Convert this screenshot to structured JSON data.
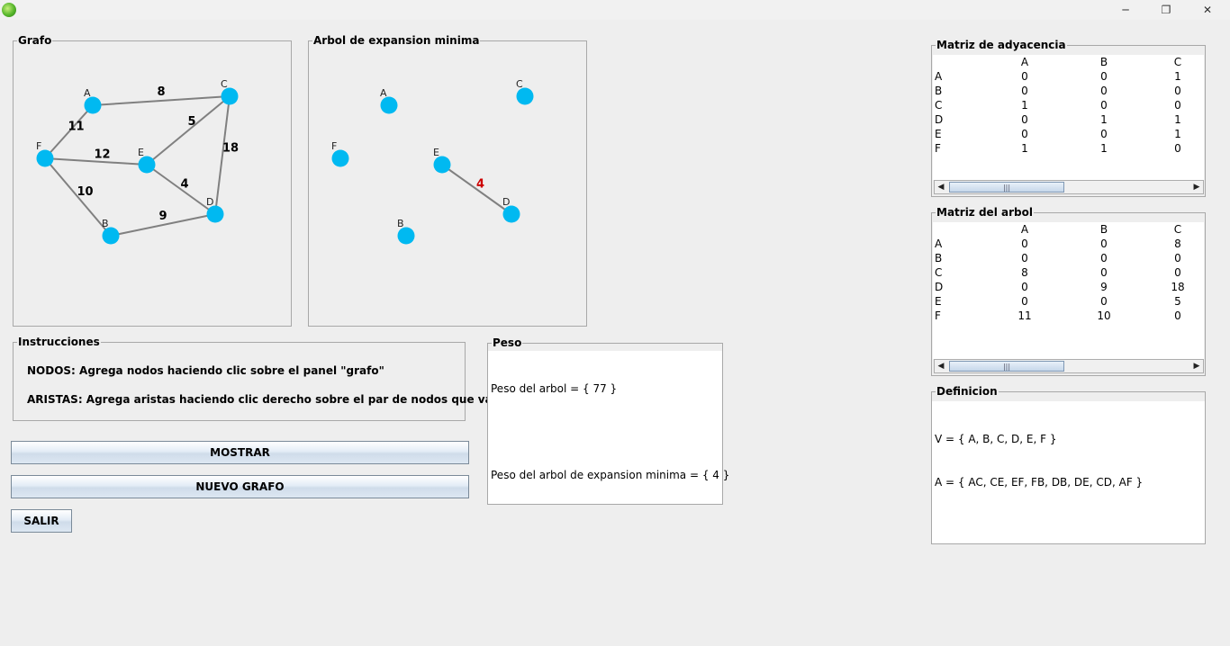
{
  "window": {
    "title_icon": "java-app-icon",
    "minimize": "─",
    "maximize": "❐",
    "close": "✕"
  },
  "grafo": {
    "legend": "Grafo",
    "node_color": "#00b9f1",
    "edge_color": "#808080",
    "nodes": [
      {
        "id": "A",
        "label": "A"
      },
      {
        "id": "B",
        "label": "B"
      },
      {
        "id": "C",
        "label": "C"
      },
      {
        "id": "D",
        "label": "D"
      },
      {
        "id": "E",
        "label": "E"
      },
      {
        "id": "F",
        "label": "F"
      }
    ],
    "edges": [
      {
        "from": "A",
        "to": "C",
        "weight": "8"
      },
      {
        "from": "F",
        "to": "A",
        "weight": "11"
      },
      {
        "from": "E",
        "to": "C",
        "weight": "5"
      },
      {
        "from": "F",
        "to": "E",
        "weight": "12"
      },
      {
        "from": "C",
        "to": "D",
        "weight": "18"
      },
      {
        "from": "E",
        "to": "D",
        "weight": "4"
      },
      {
        "from": "F",
        "to": "B",
        "weight": "10"
      },
      {
        "from": "B",
        "to": "D",
        "weight": "9"
      }
    ]
  },
  "arbol": {
    "legend": "Arbol de expansion minima",
    "highlight_color": "#cc0000",
    "nodes": [
      {
        "id": "A",
        "label": "A"
      },
      {
        "id": "B",
        "label": "B"
      },
      {
        "id": "C",
        "label": "C"
      },
      {
        "id": "D",
        "label": "D"
      },
      {
        "id": "E",
        "label": "E"
      },
      {
        "id": "F",
        "label": "F"
      }
    ],
    "edges": [
      {
        "from": "E",
        "to": "D",
        "weight": "4"
      }
    ]
  },
  "instrucciones": {
    "legend": "Instrucciones",
    "line1": "NODOS: Agrega nodos haciendo clic sobre el panel \"grafo\"",
    "line2": "ARISTAS: Agrega aristas haciendo clic derecho sobre el par de nodos que va a unir"
  },
  "buttons": {
    "mostrar": "MOSTRAR",
    "nuevo_grafo": "NUEVO GRAFO",
    "salir": "SALIR"
  },
  "peso": {
    "legend": "Peso",
    "line1": "Peso del arbol = { 77 }",
    "line2": "Peso del arbol de expansion minima = { 4 }"
  },
  "matriz_adyacencia": {
    "legend": "Matriz de adyacencia",
    "columns": [
      "",
      "A",
      "B",
      "C"
    ],
    "rows": [
      [
        "A",
        "0",
        "0",
        "1"
      ],
      [
        "B",
        "0",
        "0",
        "0"
      ],
      [
        "C",
        "1",
        "0",
        "0"
      ],
      [
        "D",
        "0",
        "1",
        "1"
      ],
      [
        "E",
        "0",
        "0",
        "1"
      ],
      [
        "F",
        "1",
        "1",
        "0"
      ]
    ]
  },
  "matriz_arbol": {
    "legend": "Matriz del arbol",
    "columns": [
      "",
      "A",
      "B",
      "C"
    ],
    "rows": [
      [
        "A",
        "0",
        "0",
        "8"
      ],
      [
        "B",
        "0",
        "0",
        "0"
      ],
      [
        "C",
        "8",
        "0",
        "0"
      ],
      [
        "D",
        "0",
        "9",
        "18"
      ],
      [
        "E",
        "0",
        "0",
        "5"
      ],
      [
        "F",
        "11",
        "10",
        "0"
      ]
    ]
  },
  "definicion": {
    "legend": "Definicion",
    "line1": "V = { A, B, C, D, E, F }",
    "line2": "A = { AC, CE, EF, FB, DB, DE, CD, AF }"
  },
  "scroll": {
    "left_arrow": "◀",
    "right_arrow": "▶",
    "thumb_grip": "|||"
  }
}
